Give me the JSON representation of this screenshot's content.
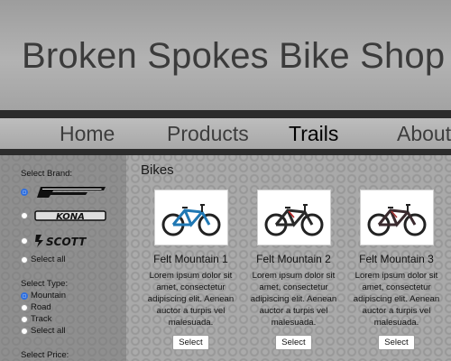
{
  "header": {
    "title": "Broken Spokes Bike Shop"
  },
  "nav": {
    "items": [
      "Home",
      "Products",
      "Trails",
      "About"
    ],
    "active": "Trails"
  },
  "sidebar": {
    "brand_heading": "Select Brand:",
    "brands": [
      {
        "name": "FELT",
        "selected": true
      },
      {
        "name": "KONA",
        "selected": false
      },
      {
        "name": "SCOTT",
        "selected": false
      }
    ],
    "brand_select_all": "Select all",
    "type_heading": "Select Type:",
    "types": [
      {
        "label": "Mountain",
        "selected": true
      },
      {
        "label": "Road",
        "selected": false
      },
      {
        "label": "Track",
        "selected": false
      },
      {
        "label": "Select all",
        "selected": false
      }
    ],
    "price_heading": "Select Price:"
  },
  "main": {
    "section_title": "Bikes",
    "products": [
      {
        "title": "Felt Mountain 1",
        "description": "Lorem ipsum dolor sit amet, consectetur adipiscing elit. Aenean auctor a turpis vel malesuada.",
        "button": "Select",
        "frame_color": "#1f78b4"
      },
      {
        "title": "Felt Mountain 2",
        "description": "Lorem ipsum dolor sit amet, consectetur adipiscing elit. Aenean auctor a turpis vel malesuada.",
        "button": "Select",
        "frame_color": "#2a2a2a"
      },
      {
        "title": "Felt Mountain 3",
        "description": "Lorem ipsum dolor sit amet, consectetur adipiscing elit. Aenean auctor a turpis vel malesuada.",
        "button": "Select",
        "frame_color": "#3a2a2e"
      }
    ]
  },
  "colors": {
    "active_nav": "#000000",
    "radio_selected": "#2f6fde",
    "stripe": "#2c2c2c"
  }
}
